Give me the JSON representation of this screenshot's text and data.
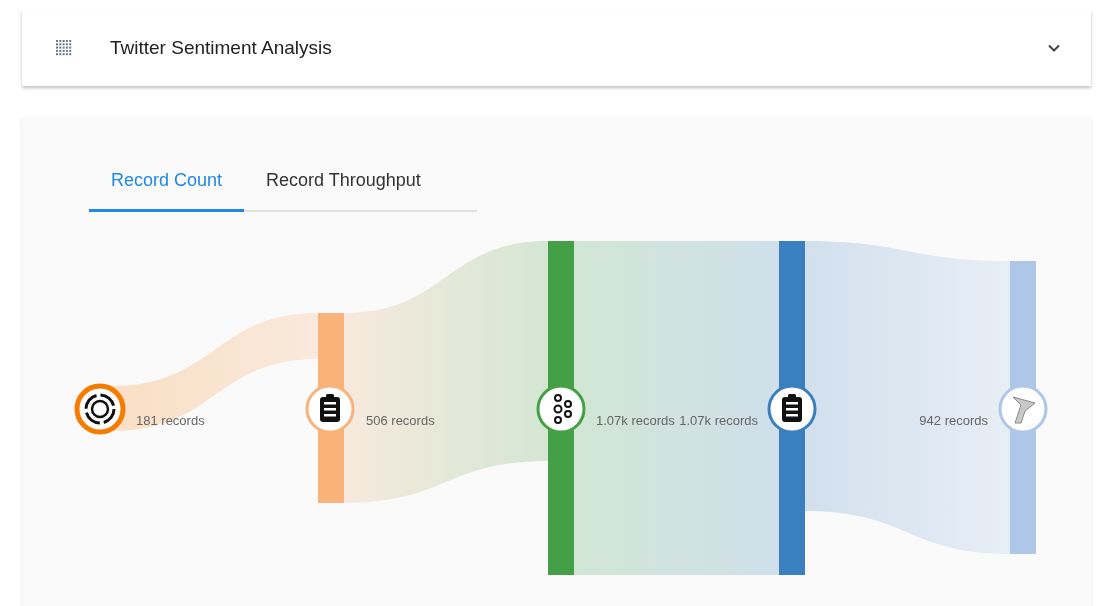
{
  "header": {
    "title": "Twitter Sentiment Analysis",
    "expanded": false
  },
  "tabs": [
    {
      "label": "Record Count",
      "selected": true
    },
    {
      "label": "Record Throughput",
      "selected": false
    }
  ],
  "flow": {
    "nodes": [
      {
        "kind": "source",
        "color": "#f57c00",
        "label": "181 records"
      },
      {
        "kind": "clipboard",
        "color": "#f8b27a",
        "label": "506 records"
      },
      {
        "kind": "kafka",
        "color": "#43a047",
        "label": "1.07k records"
      },
      {
        "kind": "clipboard",
        "color": "#3a7fbf",
        "label": "1.07k records"
      },
      {
        "kind": "sink",
        "color": "#aec7e8",
        "label": "942 records"
      }
    ]
  }
}
